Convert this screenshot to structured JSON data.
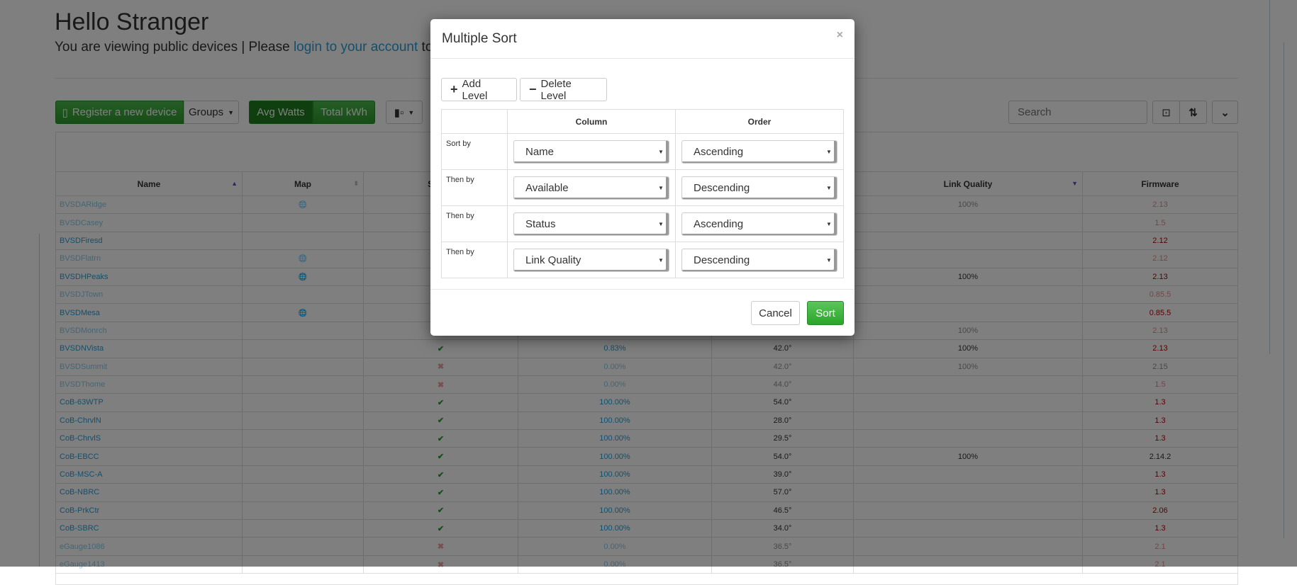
{
  "header": {
    "title": "Hello Stranger",
    "subtitle_pre": "You are viewing public devices | Please ",
    "login_link": "login to your account",
    "subtitle_post": " to view"
  },
  "toolbar": {
    "register": "Register a new device",
    "groups": "Groups",
    "avg_watts": "Avg Watts",
    "total_kwh": "Total kWh",
    "search_placeholder": "Search"
  },
  "table": {
    "headers": [
      "Name",
      "Map",
      "Status",
      "",
      "",
      "Link Quality",
      "Firmware"
    ],
    "rows": [
      {
        "name": "BVSDARidge",
        "map": true,
        "status": "",
        "avail": "",
        "temp": "",
        "link": "100%",
        "fw": "2.13",
        "dim": true,
        "fwc": "red"
      },
      {
        "name": "BVSDCasey",
        "map": false,
        "status": "",
        "avail": "",
        "temp": "",
        "link": "",
        "fw": "1.5",
        "dim": true,
        "fwc": "red"
      },
      {
        "name": "BVSDFiresd",
        "map": false,
        "status": "",
        "avail": "",
        "temp": "",
        "link": "",
        "fw": "2.12",
        "dim": false,
        "fwc": "red"
      },
      {
        "name": "BVSDFlatrn",
        "map": true,
        "status": "",
        "avail": "",
        "temp": "",
        "link": "",
        "fw": "2.12",
        "dim": true,
        "fwc": "red"
      },
      {
        "name": "BVSDHPeaks",
        "map": true,
        "status": "",
        "avail": "",
        "temp": "",
        "link": "100%",
        "fw": "2.13",
        "dim": false,
        "fwc": "red"
      },
      {
        "name": "BVSDJTown",
        "map": false,
        "status": "",
        "avail": "",
        "temp": "",
        "link": "",
        "fw": "0.85.5",
        "dim": true,
        "fwc": "red"
      },
      {
        "name": "BVSDMesa",
        "map": true,
        "status": "",
        "avail": "",
        "temp": "",
        "link": "",
        "fw": "0.85.5",
        "dim": false,
        "fwc": "red"
      },
      {
        "name": "BVSDMonrch",
        "map": false,
        "status": "",
        "avail": "",
        "temp": "",
        "link": "100%",
        "fw": "2.13",
        "dim": true,
        "fwc": "red"
      },
      {
        "name": "BVSDNVista",
        "map": false,
        "status": "ok",
        "avail": "0.83%",
        "temp": "42.0°",
        "link": "100%",
        "fw": "2.13",
        "dim": false,
        "fwc": "red"
      },
      {
        "name": "BVSDSummit",
        "map": false,
        "status": "bad",
        "avail": "0.00%",
        "temp": "42.0°",
        "link": "100%",
        "fw": "2.15",
        "dim": true,
        "fwc": "dark"
      },
      {
        "name": "BVSDThome",
        "map": false,
        "status": "bad",
        "avail": "0.00%",
        "temp": "44.0°",
        "link": "",
        "fw": "1.5",
        "dim": true,
        "fwc": "red"
      },
      {
        "name": "CoB-63WTP",
        "map": false,
        "status": "ok",
        "avail": "100.00%",
        "temp": "54.0°",
        "link": "",
        "fw": "1.3",
        "dim": false,
        "fwc": "red"
      },
      {
        "name": "CoB-ChrvlN",
        "map": false,
        "status": "ok",
        "avail": "100.00%",
        "temp": "28.0°",
        "link": "",
        "fw": "1.3",
        "dim": false,
        "fwc": "red"
      },
      {
        "name": "CoB-ChrvlS",
        "map": false,
        "status": "ok",
        "avail": "100.00%",
        "temp": "29.5°",
        "link": "",
        "fw": "1.3",
        "dim": false,
        "fwc": "red"
      },
      {
        "name": "CoB-EBCC",
        "map": false,
        "status": "ok",
        "avail": "100.00%",
        "temp": "54.0°",
        "link": "100%",
        "fw": "2.14.2",
        "dim": false,
        "fwc": "dark"
      },
      {
        "name": "CoB-MSC-A",
        "map": false,
        "status": "ok",
        "avail": "100.00%",
        "temp": "39.0°",
        "link": "",
        "fw": "1.3",
        "dim": false,
        "fwc": "red"
      },
      {
        "name": "CoB-NBRC",
        "map": false,
        "status": "ok",
        "avail": "100.00%",
        "temp": "57.0°",
        "link": "",
        "fw": "1.3",
        "dim": false,
        "fwc": "red"
      },
      {
        "name": "CoB-PrkCtr",
        "map": false,
        "status": "ok",
        "avail": "100.00%",
        "temp": "46.5°",
        "link": "",
        "fw": "2.06",
        "dim": false,
        "fwc": "red"
      },
      {
        "name": "CoB-SBRC",
        "map": false,
        "status": "ok",
        "avail": "100.00%",
        "temp": "34.0°",
        "link": "",
        "fw": "1.3",
        "dim": false,
        "fwc": "red"
      },
      {
        "name": "eGauge1086",
        "map": false,
        "status": "bad",
        "avail": "0.00%",
        "temp": "36.5°",
        "link": "",
        "fw": "2.1",
        "dim": true,
        "fwc": "red"
      },
      {
        "name": "eGauge1413",
        "map": false,
        "status": "bad",
        "avail": "0.00%",
        "temp": "36.5°",
        "link": "",
        "fw": "2.1",
        "dim": true,
        "fwc": "red"
      }
    ]
  },
  "modal": {
    "title": "Multiple Sort",
    "close": "×",
    "add_level": "Add Level",
    "delete_level": "Delete Level",
    "col_header": "Column",
    "order_header": "Order",
    "levels": [
      {
        "label": "Sort by",
        "column": "Name",
        "order": "Ascending"
      },
      {
        "label": "Then by",
        "column": "Available",
        "order": "Descending"
      },
      {
        "label": "Then by",
        "column": "Status",
        "order": "Ascending"
      },
      {
        "label": "Then by",
        "column": "Link Quality",
        "order": "Descending"
      }
    ],
    "cancel": "Cancel",
    "sort": "Sort"
  },
  "colors": {
    "accent": "#2a9fd6",
    "success": "#2d9b2d",
    "danger": "#c9302c"
  }
}
